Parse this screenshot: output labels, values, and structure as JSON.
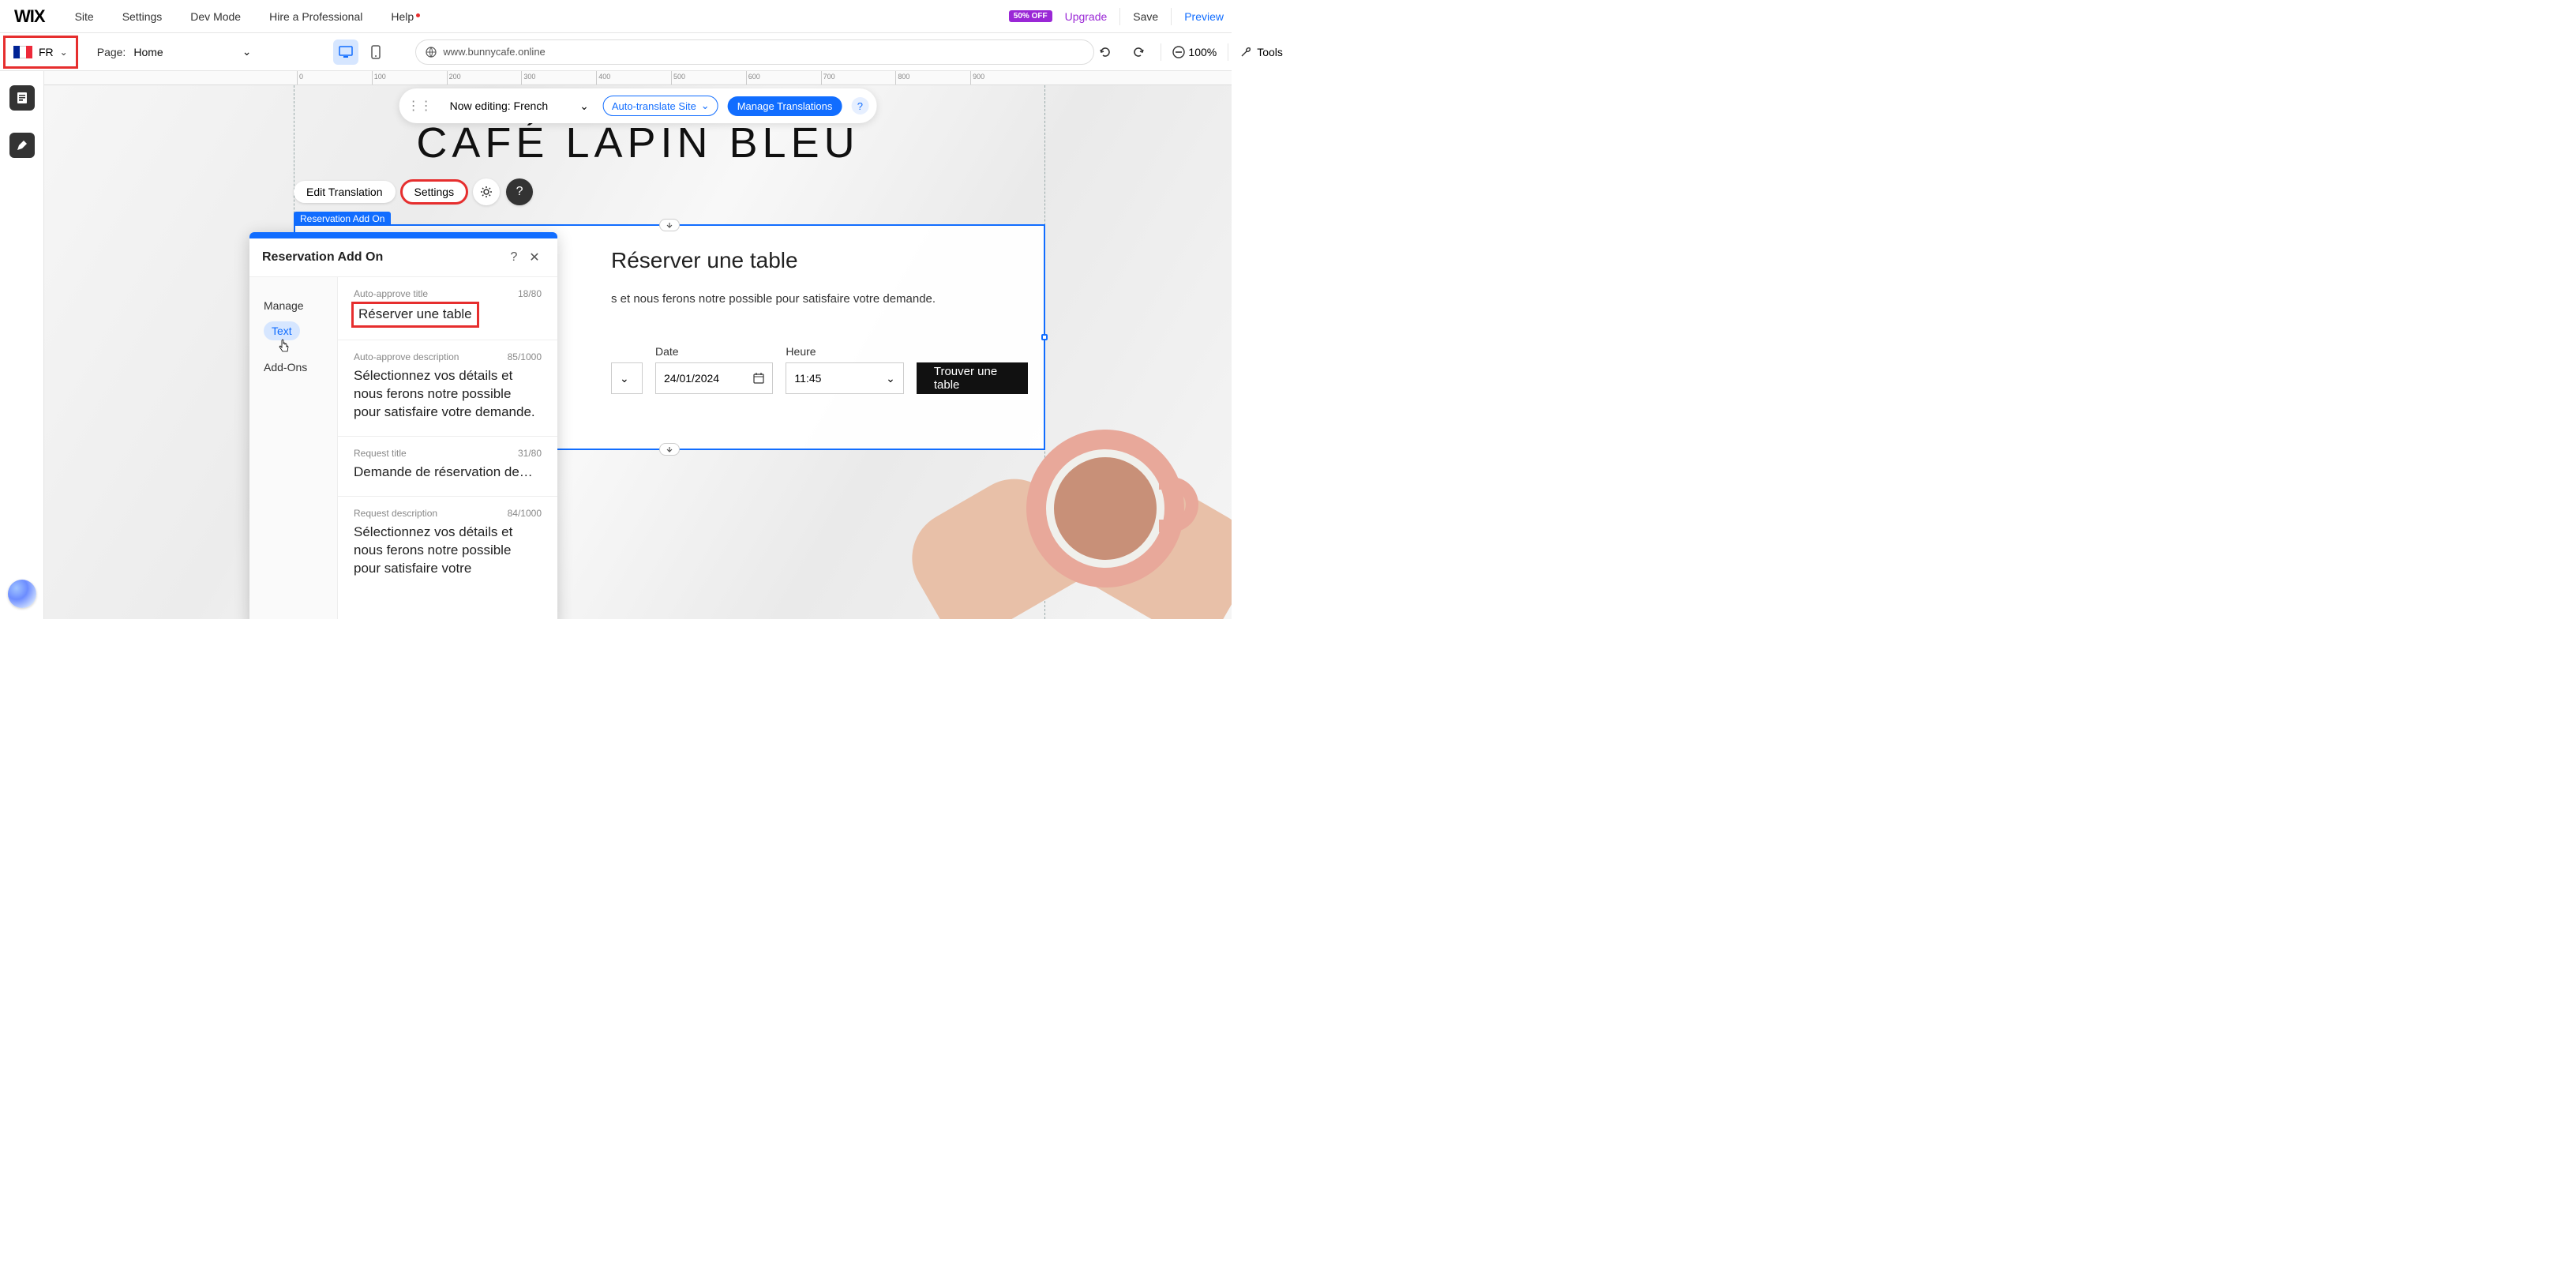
{
  "menubar": {
    "logo": "WIX",
    "items": [
      "Site",
      "Settings",
      "Dev Mode",
      "Hire a Professional",
      "Help"
    ],
    "badge": "50% OFF",
    "upgrade": "Upgrade",
    "save": "Save",
    "preview": "Preview"
  },
  "toolbar": {
    "lang_code": "FR",
    "page_label": "Page:",
    "page_value": "Home",
    "url": "www.bunnycafe.online",
    "zoom": "100%",
    "tools": "Tools"
  },
  "float_bar": {
    "editing_label": "Now editing: French",
    "auto_translate": "Auto-translate Site",
    "manage": "Manage Translations"
  },
  "site": {
    "title": "CAFÉ LAPIN BLEU"
  },
  "pills": {
    "edit_translation": "Edit Translation",
    "settings": "Settings"
  },
  "selection": {
    "label": "Reservation Add On"
  },
  "widget": {
    "title": "Réserver une table",
    "description": "s et nous ferons notre possible pour satisfaire votre demande.",
    "date_label": "Date",
    "date_value": "24/01/2024",
    "time_label": "Heure",
    "time_value": "11:45",
    "find_btn": "Trouver une table"
  },
  "panel": {
    "title": "Reservation Add On",
    "nav": {
      "manage": "Manage",
      "text": "Text",
      "addons": "Add-Ons"
    },
    "rows": [
      {
        "label": "Auto-approve title",
        "count": "18/80",
        "value": "Réserver une table"
      },
      {
        "label": "Auto-approve description",
        "count": "85/1000",
        "value": "Sélectionnez vos détails et nous ferons notre possible pour satisfaire votre demande."
      },
      {
        "label": "Request title",
        "count": "31/80",
        "value": "Demande de réservation de…"
      },
      {
        "label": "Request description",
        "count": "84/1000",
        "value": "Sélectionnez vos détails et nous ferons notre possible pour satisfaire votre"
      }
    ]
  },
  "ruler_ticks": [
    "0",
    "100",
    "200",
    "300",
    "400",
    "500",
    "600",
    "700",
    "800",
    "900"
  ]
}
